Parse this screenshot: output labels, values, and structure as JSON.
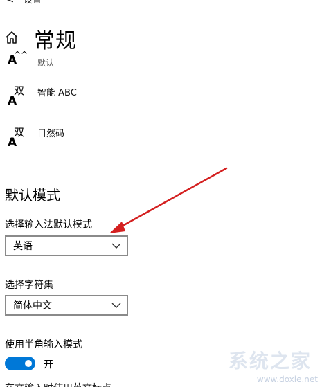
{
  "header": {
    "back_glyph": "<",
    "breadcrumb_title": "设置"
  },
  "page": {
    "title": "常规"
  },
  "ime_list": [
    {
      "icon_text_a": "A",
      "icon_text_b": "^^",
      "label": "默认"
    },
    {
      "icon_text_a": "A",
      "icon_text_b": "双",
      "label": "智能 ABC"
    },
    {
      "icon_text_a": "A",
      "icon_text_b": "双",
      "label": "目然码"
    }
  ],
  "default_mode": {
    "heading": "默认模式",
    "ime_default_label": "选择输入法默认模式",
    "ime_default_value": "英语",
    "charset_label": "选择字符集",
    "charset_value": "简体中文",
    "halfwidth_label": "使用半角输入模式",
    "halfwidth_state_label": "开",
    "halfwidth_on": true,
    "next_label_cut": "在文输入时使用英文标点"
  },
  "annotation": {
    "arrow_color": "#d42020"
  },
  "watermark": {
    "logo_text": "系统之家",
    "url": "www.doxie.net"
  },
  "colors": {
    "accent": "#0078d7",
    "border": "#8a8a8a"
  }
}
